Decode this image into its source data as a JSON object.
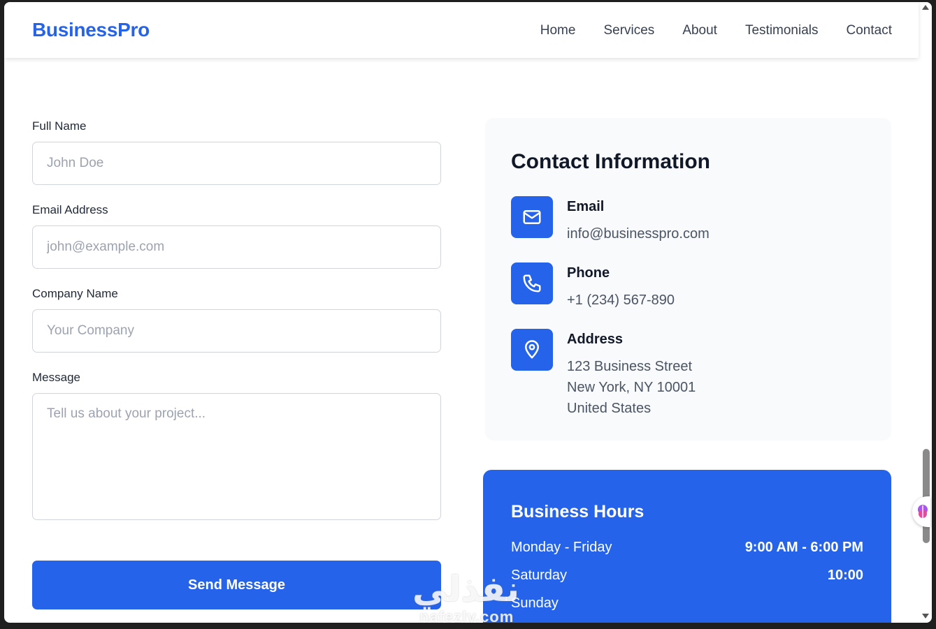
{
  "brand": "BusinessPro",
  "nav": [
    "Home",
    "Services",
    "About",
    "Testimonials",
    "Contact"
  ],
  "form": {
    "full_name": {
      "label": "Full Name",
      "placeholder": "John Doe"
    },
    "email": {
      "label": "Email Address",
      "placeholder": "john@example.com"
    },
    "company": {
      "label": "Company Name",
      "placeholder": "Your Company"
    },
    "message": {
      "label": "Message",
      "placeholder": "Tell us about your project..."
    },
    "submit": "Send Message"
  },
  "contact_info": {
    "title": "Contact Information",
    "email": {
      "label": "Email",
      "value": "info@businesspro.com",
      "icon": "mail-icon"
    },
    "phone": {
      "label": "Phone",
      "value": "+1 (234) 567-890",
      "icon": "phone-icon"
    },
    "address": {
      "label": "Address",
      "lines": [
        "123 Business Street",
        "New York, NY 10001",
        "United States"
      ],
      "icon": "map-pin-icon"
    }
  },
  "hours": {
    "title": "Business Hours",
    "rows": [
      {
        "day": "Monday - Friday",
        "time": "9:00 AM - 6:00 PM"
      },
      {
        "day": "Saturday",
        "time": "10:00"
      },
      {
        "day": "Sunday",
        "time": ""
      }
    ]
  },
  "watermark": {
    "arabic": "نفذلي",
    "latin": "nafezly.com"
  },
  "colors": {
    "primary": "#2563eb",
    "card_bg": "#f8fafc"
  }
}
